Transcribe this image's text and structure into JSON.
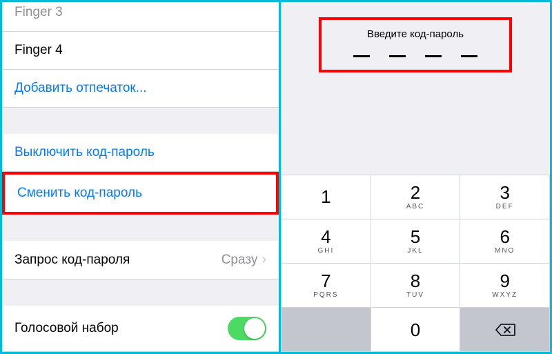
{
  "left": {
    "finger3": "Finger 3",
    "finger4": "Finger 4",
    "add_fingerprint": "Добавить отпечаток...",
    "disable_passcode": "Выключить код-пароль",
    "change_passcode": "Сменить код-пароль",
    "require_passcode_label": "Запрос код-пароля",
    "require_passcode_value": "Сразу",
    "voice_dial": "Голосовой набор",
    "voice_dial_on": true
  },
  "right": {
    "enter_passcode": "Введите код-пароль",
    "keys": [
      [
        {
          "d": "1",
          "l": ""
        },
        {
          "d": "2",
          "l": "ABC"
        },
        {
          "d": "3",
          "l": "DEF"
        }
      ],
      [
        {
          "d": "4",
          "l": "GHI"
        },
        {
          "d": "5",
          "l": "JKL"
        },
        {
          "d": "6",
          "l": "MNO"
        }
      ],
      [
        {
          "d": "7",
          "l": "PQRS"
        },
        {
          "d": "8",
          "l": "TUV"
        },
        {
          "d": "9",
          "l": "WXYZ"
        }
      ]
    ],
    "zero": {
      "d": "0",
      "l": ""
    }
  }
}
